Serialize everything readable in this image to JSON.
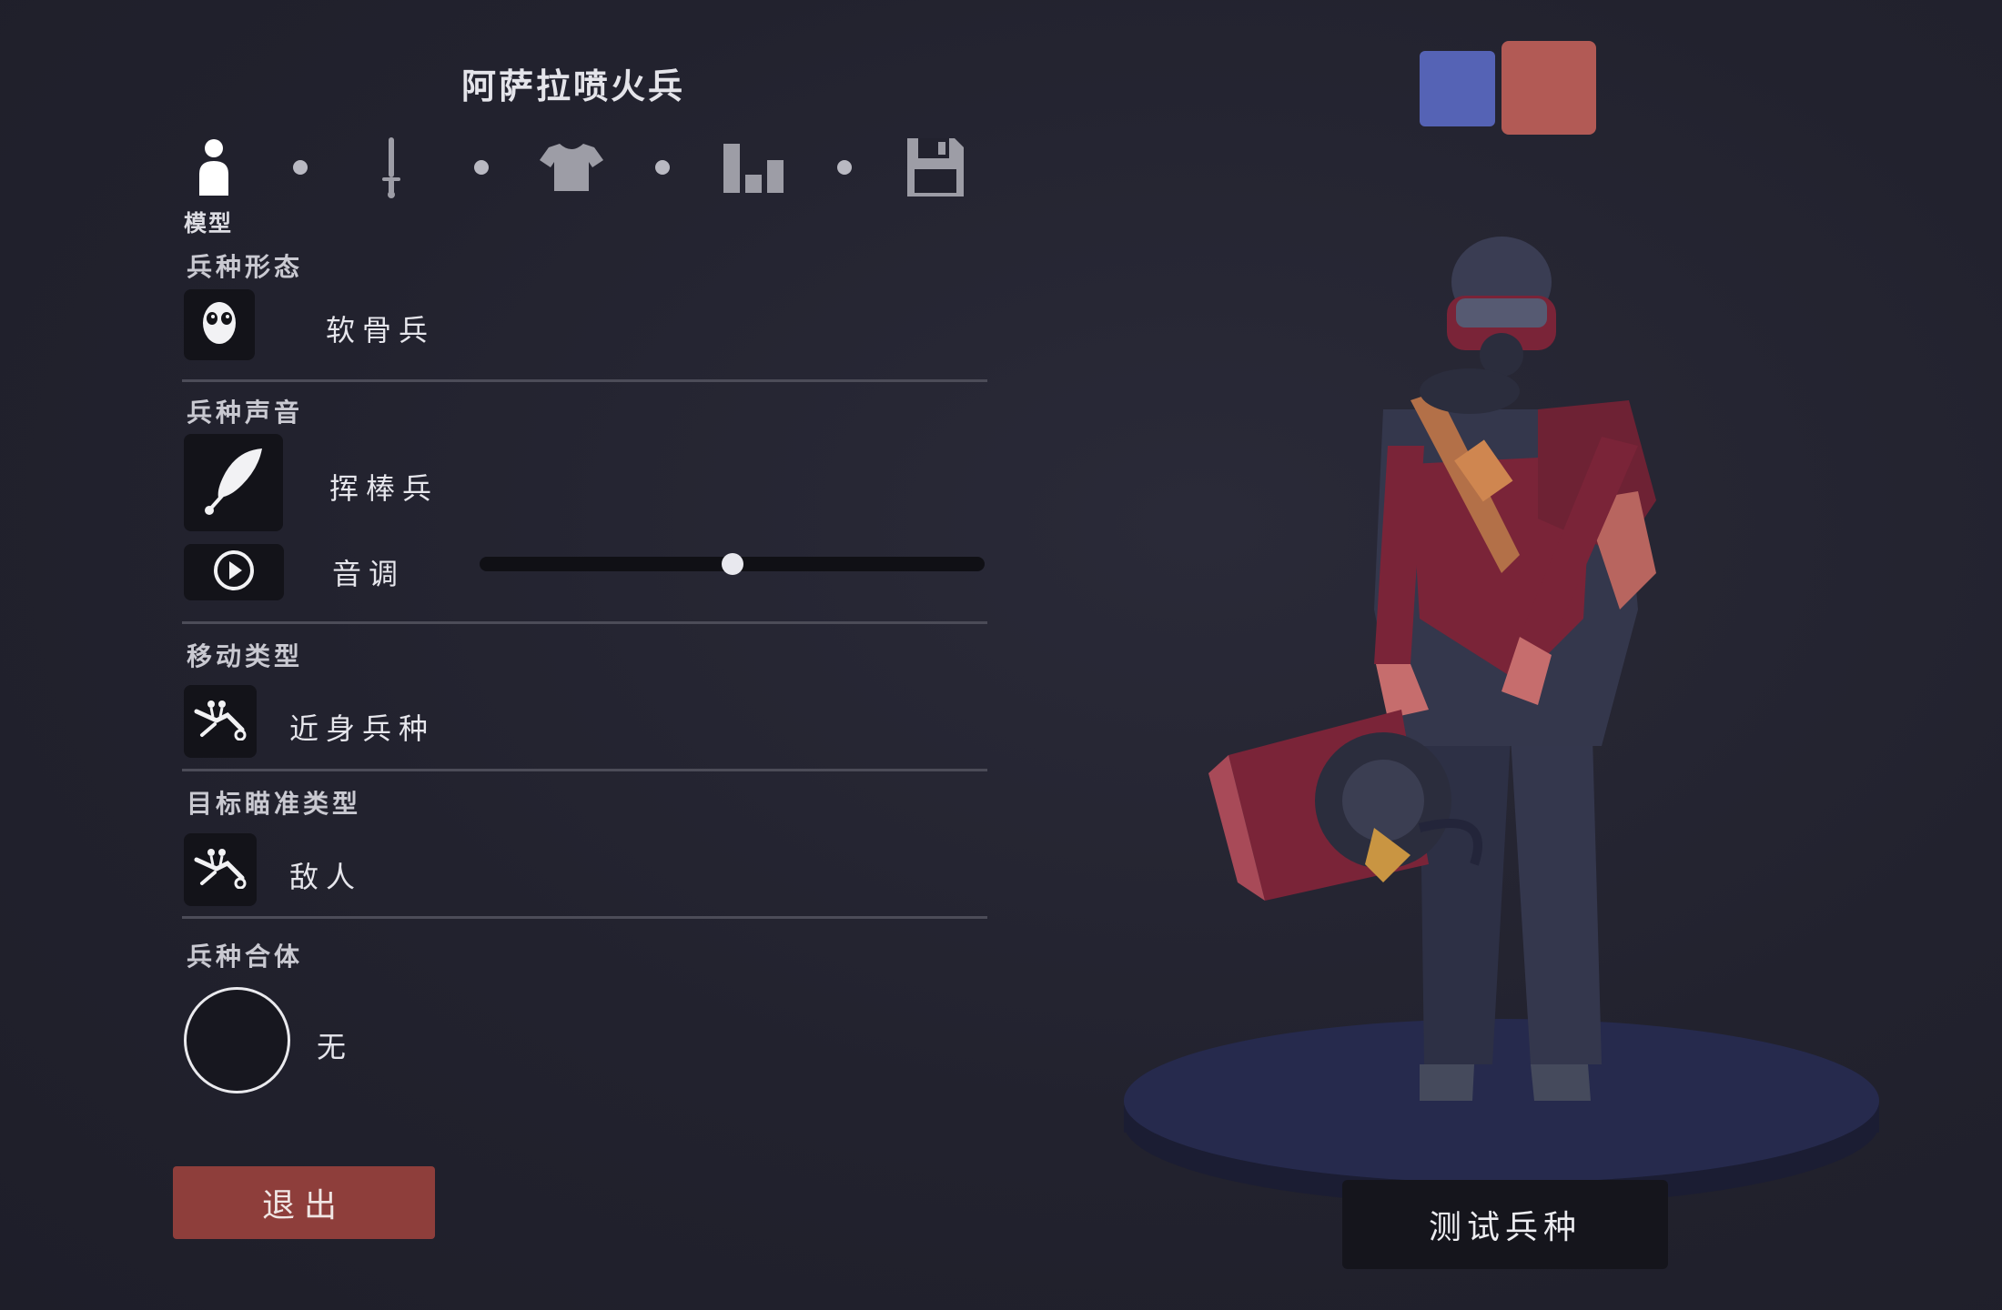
{
  "unit_name": "阿萨拉喷火兵",
  "steps": {
    "active_label": "模型",
    "icons": [
      "person-icon",
      "sword-icon",
      "shirt-icon",
      "stats-icon",
      "save-icon"
    ]
  },
  "sections": {
    "form": {
      "label": "兵种形态",
      "value": "软骨兵",
      "icon": "skull-mask-icon"
    },
    "voice": {
      "label": "兵种声音",
      "value": "挥棒兵",
      "icon": "feather-icon"
    },
    "pitch": {
      "label": "音调",
      "icon": "play-icon",
      "level": 0.5
    },
    "movement": {
      "label": "移动类型",
      "value": "近身兵种",
      "icon": "charge-icon"
    },
    "targeting": {
      "label": "目标瞄准类型",
      "value": "敌人",
      "icon": "charge-icon"
    },
    "combination": {
      "label": "兵种合体",
      "value": "无"
    }
  },
  "buttons": {
    "exit": "退出",
    "test_unit": "测试兵种"
  },
  "team_colors": {
    "blue": "#5563b5",
    "red": "#b25a55"
  }
}
